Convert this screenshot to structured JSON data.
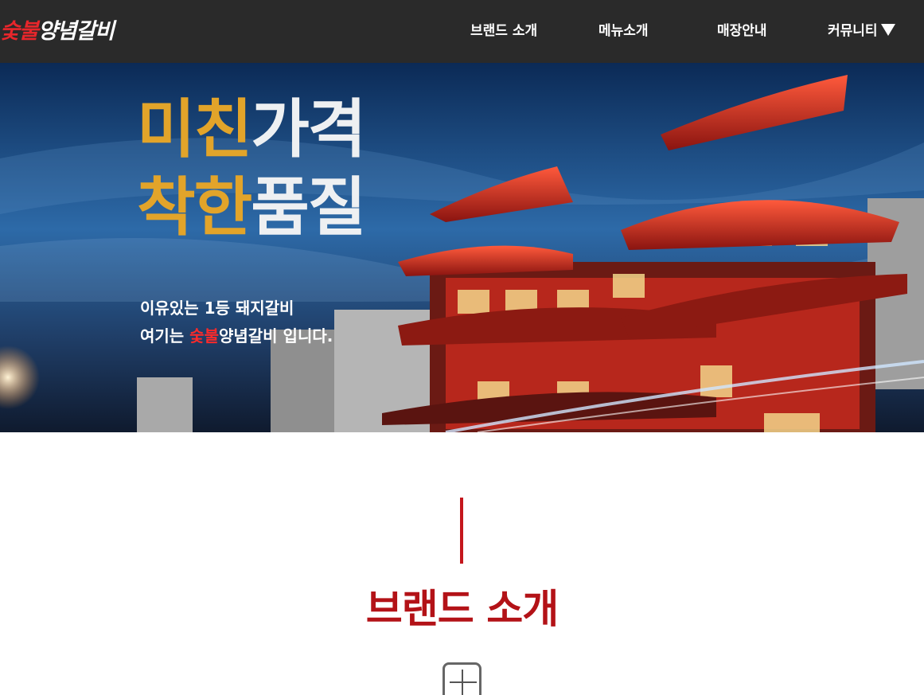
{
  "header": {
    "logo": {
      "part_red": "숯불",
      "part_white": "양념갈비"
    },
    "nav": [
      {
        "label": "브랜드 소개"
      },
      {
        "label": "메뉴소개"
      },
      {
        "label": "매장안내"
      },
      {
        "label": "커뮤니티"
      }
    ]
  },
  "hero": {
    "line1_gold": "미친",
    "line1_white": "가격",
    "line2_gold": "착한",
    "line2_white": "품질",
    "sub1": "이유있는 1등 돼지갈비",
    "sub2_prefix": "여기는 ",
    "sub2_red": "숯불",
    "sub2_brand": "양념갈비",
    "sub2_suffix": " 입니다."
  },
  "section": {
    "title": "브랜드 소개"
  },
  "colors": {
    "header_bg": "#2a2a2a",
    "accent_red": "#b31217",
    "gold": "#e2a42a"
  }
}
